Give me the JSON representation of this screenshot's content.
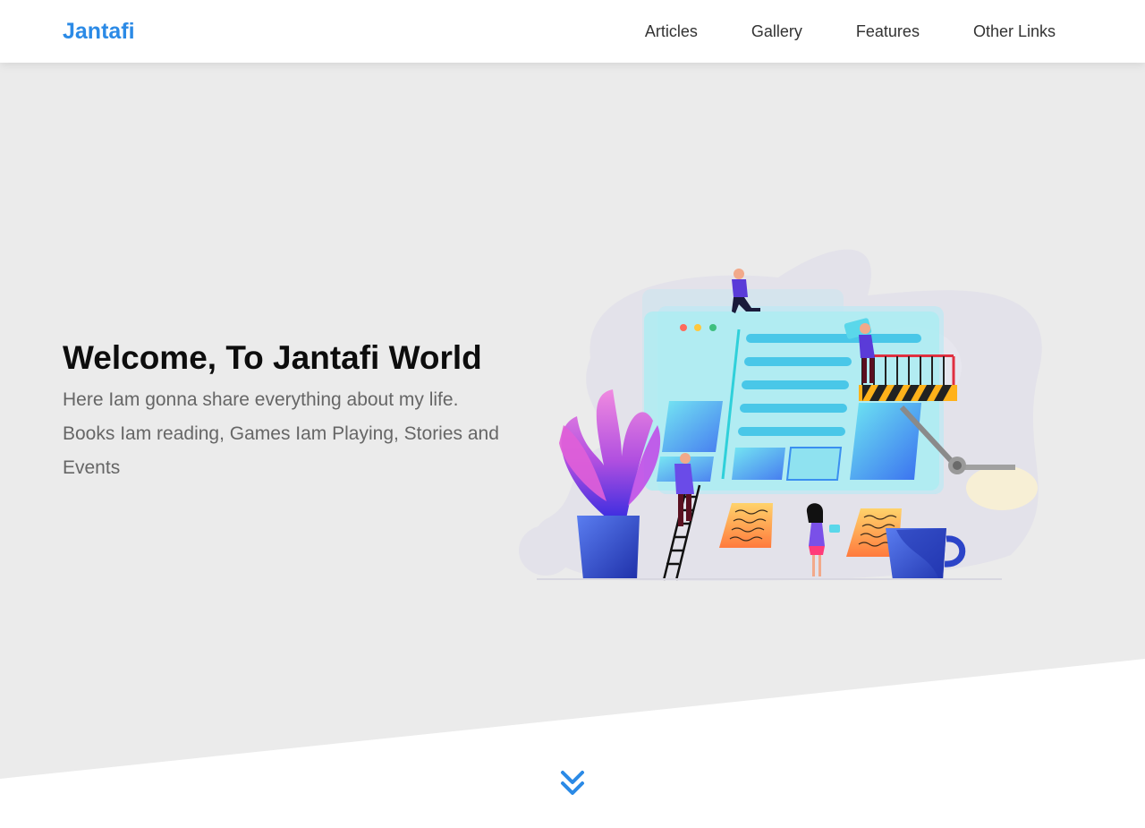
{
  "brand": {
    "name": "Jantafi",
    "color": "#2b8ae6"
  },
  "nav": {
    "items": [
      {
        "label": "Articles"
      },
      {
        "label": "Gallery"
      },
      {
        "label": "Features"
      },
      {
        "label": "Other Links"
      }
    ]
  },
  "hero": {
    "title": "Welcome, To Jantafi World",
    "text": "Here Iam gonna share everything about my life. Books Iam reading, Games Iam Playing, Stories and Events",
    "background_color": "#ebebeb"
  },
  "illustration": {
    "icon": "website-building-illustration"
  },
  "scroll": {
    "icon": "double-chevron-down-icon",
    "color": "#2b8ae6"
  }
}
